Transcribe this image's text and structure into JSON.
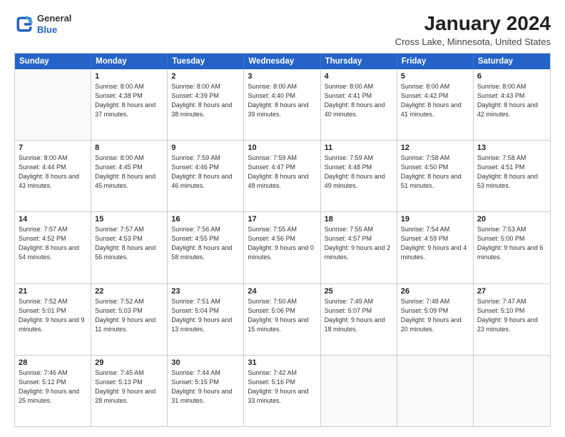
{
  "header": {
    "logo": {
      "general": "General",
      "blue": "Blue"
    },
    "title": "January 2024",
    "location": "Cross Lake, Minnesota, United States"
  },
  "days_of_week": [
    "Sunday",
    "Monday",
    "Tuesday",
    "Wednesday",
    "Thursday",
    "Friday",
    "Saturday"
  ],
  "weeks": [
    [
      {
        "day": "",
        "empty": true
      },
      {
        "day": "1",
        "sunrise": "Sunrise: 8:00 AM",
        "sunset": "Sunset: 4:38 PM",
        "daylight": "Daylight: 8 hours and 37 minutes."
      },
      {
        "day": "2",
        "sunrise": "Sunrise: 8:00 AM",
        "sunset": "Sunset: 4:39 PM",
        "daylight": "Daylight: 8 hours and 38 minutes."
      },
      {
        "day": "3",
        "sunrise": "Sunrise: 8:00 AM",
        "sunset": "Sunset: 4:40 PM",
        "daylight": "Daylight: 8 hours and 39 minutes."
      },
      {
        "day": "4",
        "sunrise": "Sunrise: 8:00 AM",
        "sunset": "Sunset: 4:41 PM",
        "daylight": "Daylight: 8 hours and 40 minutes."
      },
      {
        "day": "5",
        "sunrise": "Sunrise: 8:00 AM",
        "sunset": "Sunset: 4:42 PM",
        "daylight": "Daylight: 8 hours and 41 minutes."
      },
      {
        "day": "6",
        "sunrise": "Sunrise: 8:00 AM",
        "sunset": "Sunset: 4:43 PM",
        "daylight": "Daylight: 8 hours and 42 minutes."
      }
    ],
    [
      {
        "day": "7",
        "sunrise": "Sunrise: 8:00 AM",
        "sunset": "Sunset: 4:44 PM",
        "daylight": "Daylight: 8 hours and 43 minutes."
      },
      {
        "day": "8",
        "sunrise": "Sunrise: 8:00 AM",
        "sunset": "Sunset: 4:45 PM",
        "daylight": "Daylight: 8 hours and 45 minutes."
      },
      {
        "day": "9",
        "sunrise": "Sunrise: 7:59 AM",
        "sunset": "Sunset: 4:46 PM",
        "daylight": "Daylight: 8 hours and 46 minutes."
      },
      {
        "day": "10",
        "sunrise": "Sunrise: 7:59 AM",
        "sunset": "Sunset: 4:47 PM",
        "daylight": "Daylight: 8 hours and 48 minutes."
      },
      {
        "day": "11",
        "sunrise": "Sunrise: 7:59 AM",
        "sunset": "Sunset: 4:48 PM",
        "daylight": "Daylight: 8 hours and 49 minutes."
      },
      {
        "day": "12",
        "sunrise": "Sunrise: 7:58 AM",
        "sunset": "Sunset: 4:50 PM",
        "daylight": "Daylight: 8 hours and 51 minutes."
      },
      {
        "day": "13",
        "sunrise": "Sunrise: 7:58 AM",
        "sunset": "Sunset: 4:51 PM",
        "daylight": "Daylight: 8 hours and 53 minutes."
      }
    ],
    [
      {
        "day": "14",
        "sunrise": "Sunrise: 7:57 AM",
        "sunset": "Sunset: 4:52 PM",
        "daylight": "Daylight: 8 hours and 54 minutes."
      },
      {
        "day": "15",
        "sunrise": "Sunrise: 7:57 AM",
        "sunset": "Sunset: 4:53 PM",
        "daylight": "Daylight: 8 hours and 56 minutes."
      },
      {
        "day": "16",
        "sunrise": "Sunrise: 7:56 AM",
        "sunset": "Sunset: 4:55 PM",
        "daylight": "Daylight: 8 hours and 58 minutes."
      },
      {
        "day": "17",
        "sunrise": "Sunrise: 7:55 AM",
        "sunset": "Sunset: 4:56 PM",
        "daylight": "Daylight: 9 hours and 0 minutes."
      },
      {
        "day": "18",
        "sunrise": "Sunrise: 7:55 AM",
        "sunset": "Sunset: 4:57 PM",
        "daylight": "Daylight: 9 hours and 2 minutes."
      },
      {
        "day": "19",
        "sunrise": "Sunrise: 7:54 AM",
        "sunset": "Sunset: 4:59 PM",
        "daylight": "Daylight: 9 hours and 4 minutes."
      },
      {
        "day": "20",
        "sunrise": "Sunrise: 7:53 AM",
        "sunset": "Sunset: 5:00 PM",
        "daylight": "Daylight: 9 hours and 6 minutes."
      }
    ],
    [
      {
        "day": "21",
        "sunrise": "Sunrise: 7:52 AM",
        "sunset": "Sunset: 5:01 PM",
        "daylight": "Daylight: 9 hours and 9 minutes."
      },
      {
        "day": "22",
        "sunrise": "Sunrise: 7:52 AM",
        "sunset": "Sunset: 5:03 PM",
        "daylight": "Daylight: 9 hours and 11 minutes."
      },
      {
        "day": "23",
        "sunrise": "Sunrise: 7:51 AM",
        "sunset": "Sunset: 5:04 PM",
        "daylight": "Daylight: 9 hours and 13 minutes."
      },
      {
        "day": "24",
        "sunrise": "Sunrise: 7:50 AM",
        "sunset": "Sunset: 5:06 PM",
        "daylight": "Daylight: 9 hours and 15 minutes."
      },
      {
        "day": "25",
        "sunrise": "Sunrise: 7:49 AM",
        "sunset": "Sunset: 5:07 PM",
        "daylight": "Daylight: 9 hours and 18 minutes."
      },
      {
        "day": "26",
        "sunrise": "Sunrise: 7:48 AM",
        "sunset": "Sunset: 5:09 PM",
        "daylight": "Daylight: 9 hours and 20 minutes."
      },
      {
        "day": "27",
        "sunrise": "Sunrise: 7:47 AM",
        "sunset": "Sunset: 5:10 PM",
        "daylight": "Daylight: 9 hours and 23 minutes."
      }
    ],
    [
      {
        "day": "28",
        "sunrise": "Sunrise: 7:46 AM",
        "sunset": "Sunset: 5:12 PM",
        "daylight": "Daylight: 9 hours and 25 minutes."
      },
      {
        "day": "29",
        "sunrise": "Sunrise: 7:45 AM",
        "sunset": "Sunset: 5:13 PM",
        "daylight": "Daylight: 9 hours and 28 minutes."
      },
      {
        "day": "30",
        "sunrise": "Sunrise: 7:44 AM",
        "sunset": "Sunset: 5:15 PM",
        "daylight": "Daylight: 9 hours and 31 minutes."
      },
      {
        "day": "31",
        "sunrise": "Sunrise: 7:42 AM",
        "sunset": "Sunset: 5:16 PM",
        "daylight": "Daylight: 9 hours and 33 minutes."
      },
      {
        "day": "",
        "empty": true
      },
      {
        "day": "",
        "empty": true
      },
      {
        "day": "",
        "empty": true
      }
    ]
  ]
}
